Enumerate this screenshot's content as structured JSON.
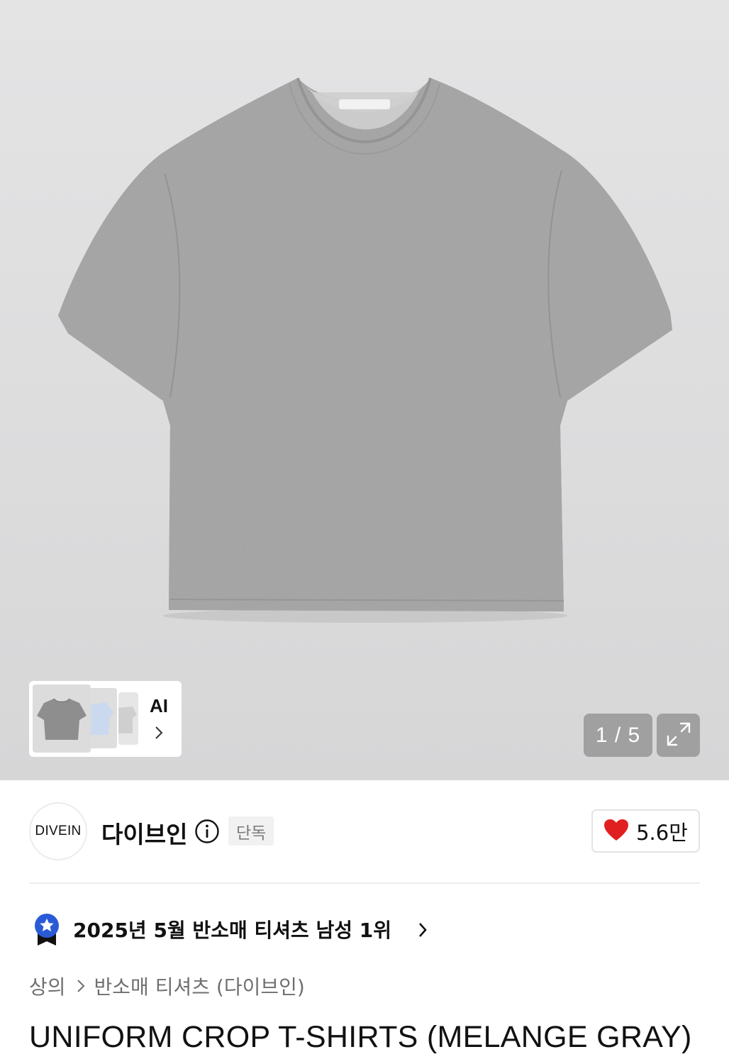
{
  "gallery": {
    "counter": "1 / 5",
    "ai_label": "AI"
  },
  "brand": {
    "logo_text": "DIVEIN",
    "name": "다이브인",
    "badge": "단독"
  },
  "like": {
    "count": "5.6만",
    "icon": "heart-icon",
    "color": "#e02020"
  },
  "ranking": {
    "text": "2025년 5월 반소매 티셔츠 남성 1위",
    "icon": "ranking-medal-icon",
    "icon_color": "#2a5bd7"
  },
  "breadcrumb": {
    "items": [
      "상의",
      "반소매 티셔츠 (다이브인)"
    ]
  },
  "product": {
    "title": "UNIFORM CROP T-SHIRTS (MELANGE GRAY)"
  }
}
